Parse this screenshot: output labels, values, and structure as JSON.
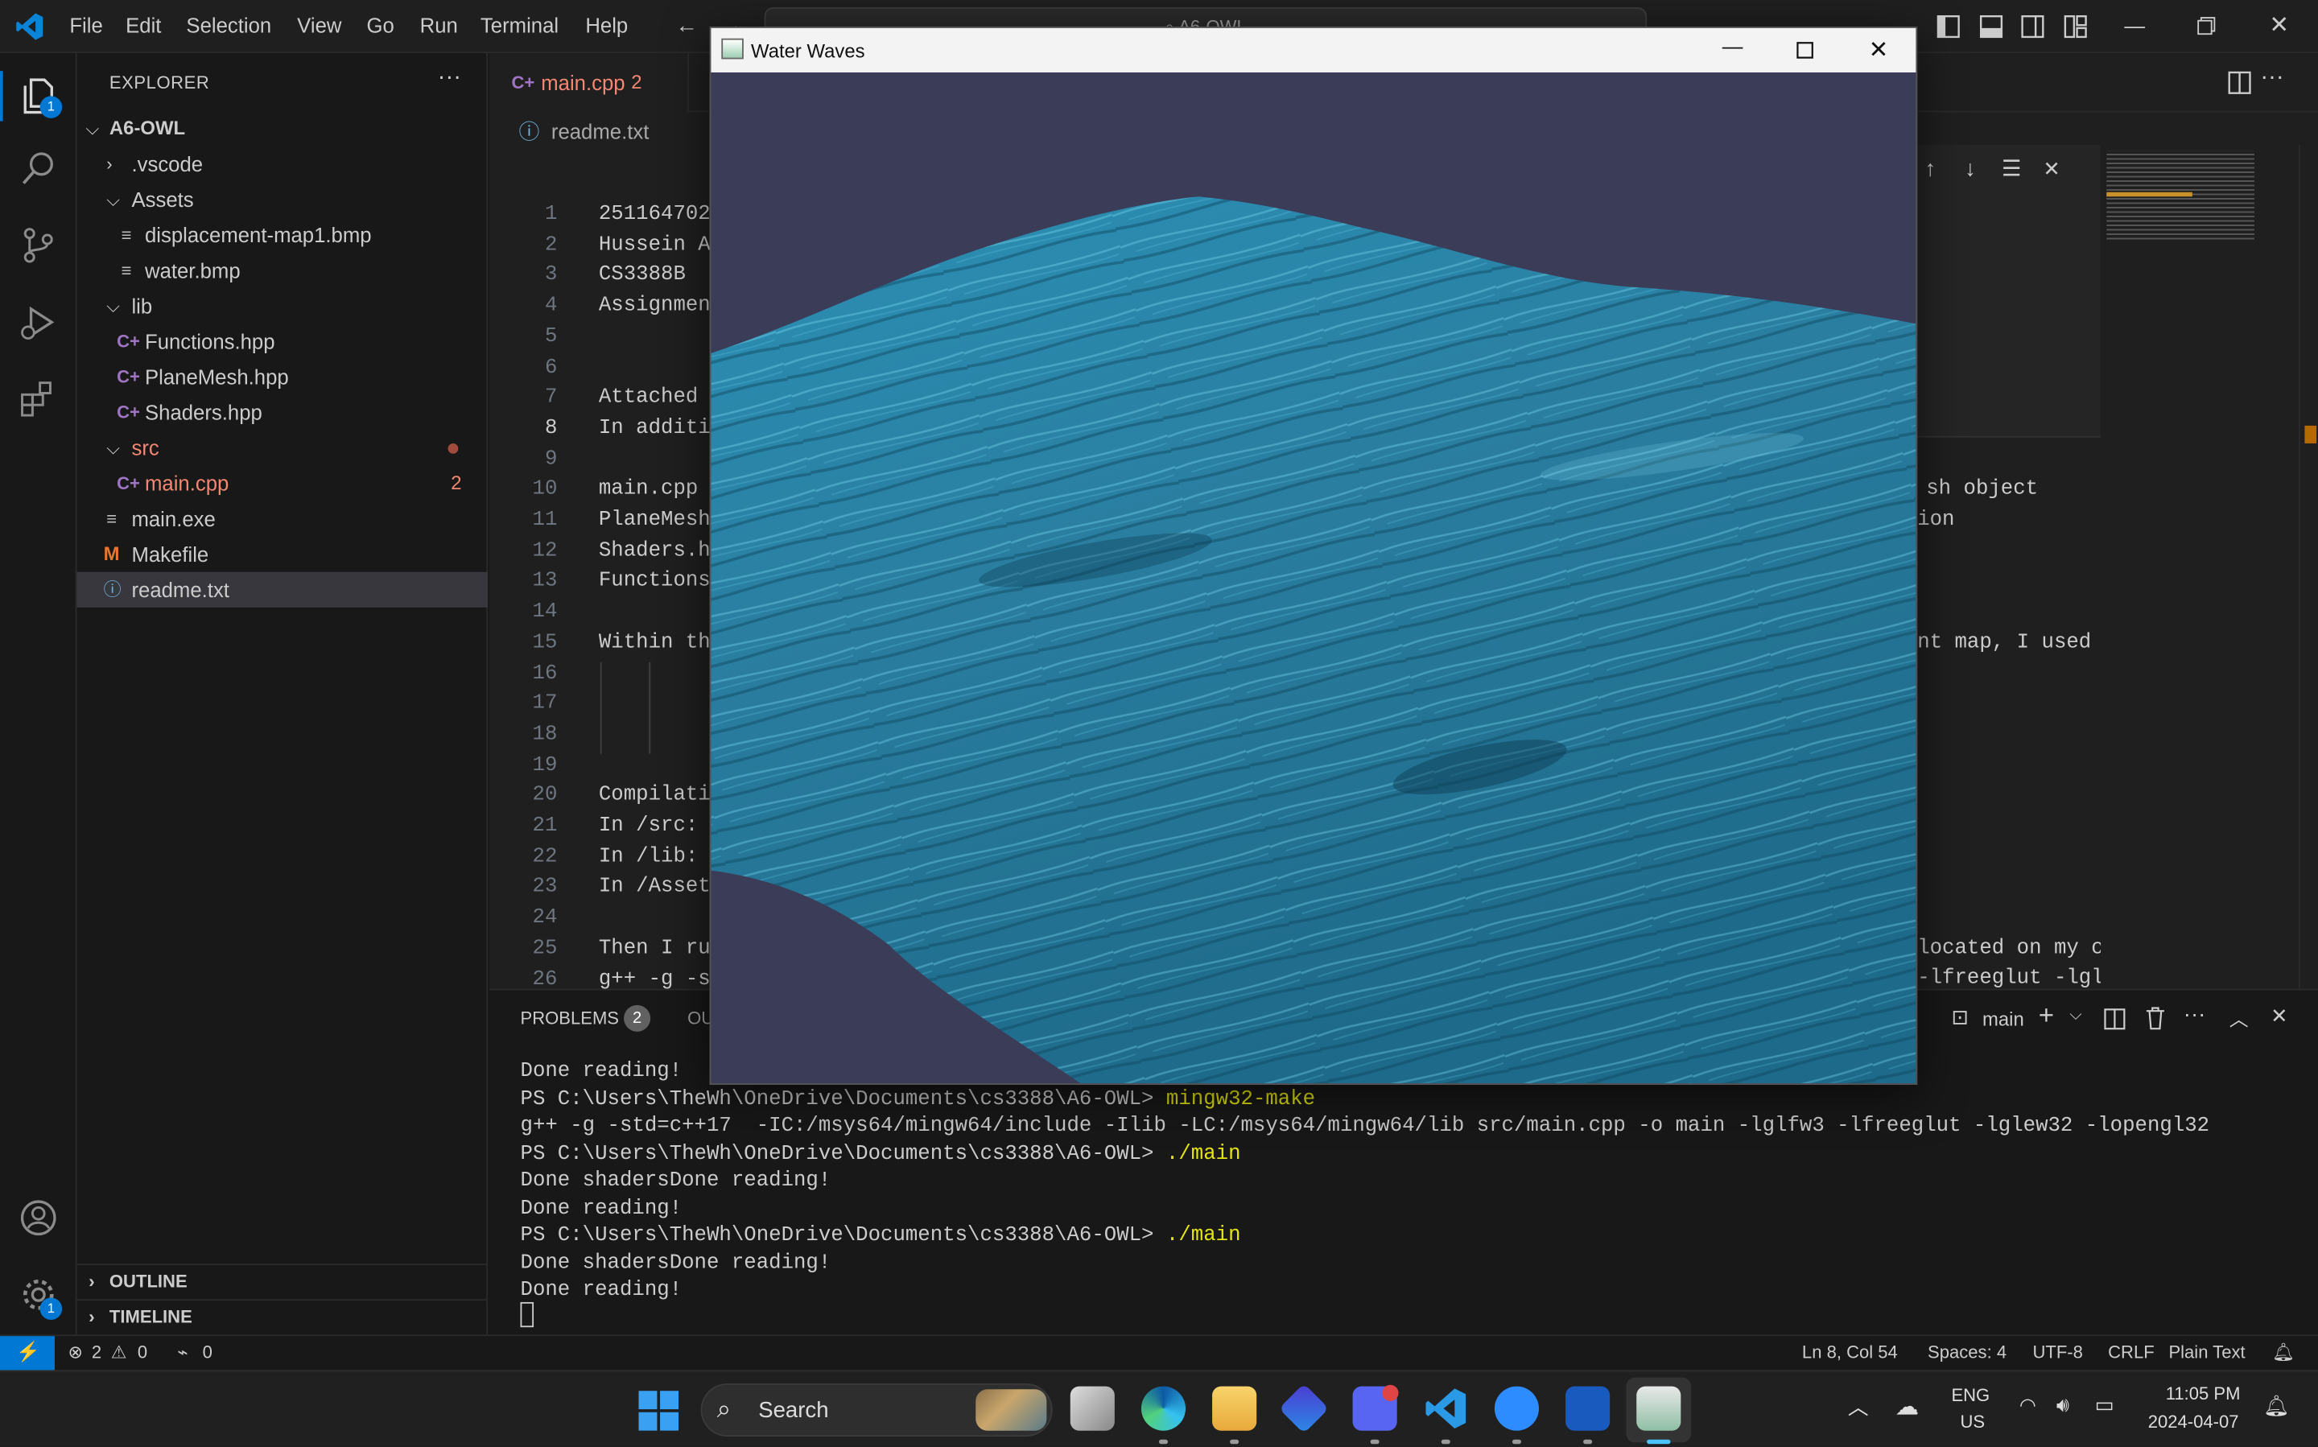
{
  "menu": [
    "File",
    "Edit",
    "Selection",
    "View",
    "Go",
    "Run",
    "Terminal",
    "Help"
  ],
  "search_box": "A6-OWL",
  "activity_badges": {
    "explorer": "1",
    "settings": "1"
  },
  "explorer": {
    "title": "EXPLORER",
    "root": "A6-OWL",
    "items": [
      {
        "name": ".vscode",
        "kind": "folder-closed"
      },
      {
        "name": "Assets",
        "kind": "folder-open"
      },
      {
        "name": "displacement-map1.bmp",
        "kind": "file"
      },
      {
        "name": "water.bmp",
        "kind": "file"
      },
      {
        "name": "lib",
        "kind": "folder-open"
      },
      {
        "name": "Functions.hpp",
        "kind": "cpp"
      },
      {
        "name": "PlaneMesh.hpp",
        "kind": "cpp"
      },
      {
        "name": "Shaders.hpp",
        "kind": "cpp"
      },
      {
        "name": "src",
        "kind": "folder-open"
      },
      {
        "name": "main.cpp",
        "kind": "cpp",
        "badge": "2"
      },
      {
        "name": "main.exe",
        "kind": "file"
      },
      {
        "name": "Makefile",
        "kind": "makefile"
      },
      {
        "name": "readme.txt",
        "kind": "text"
      }
    ],
    "outline": "OUTLINE",
    "timeline": "TIMELINE"
  },
  "tabs": [
    {
      "label": "main.cpp",
      "badge": "2"
    }
  ],
  "breadcrumb": "readme.txt",
  "editor_lines": [
    {
      "n": "1",
      "text": "251164702"
    },
    {
      "n": "2",
      "text": "Hussein A"
    },
    {
      "n": "3",
      "text": "CS3388B"
    },
    {
      "n": "4",
      "text": "Assignmen"
    },
    {
      "n": "5",
      "text": ""
    },
    {
      "n": "6",
      "text": ""
    },
    {
      "n": "7",
      "text": "Attached "
    },
    {
      "n": "8",
      "text": "In additi"
    },
    {
      "n": "9",
      "text": ""
    },
    {
      "n": "10",
      "text": "main.cpp "
    },
    {
      "n": "11",
      "text": "PlaneMesh"
    },
    {
      "n": "12",
      "text": "Shaders.h"
    },
    {
      "n": "13",
      "text": "Functions"
    },
    {
      "n": "14",
      "text": ""
    },
    {
      "n": "15",
      "text": "Within th"
    },
    {
      "n": "16",
      "text": ""
    },
    {
      "n": "17",
      "text": ""
    },
    {
      "n": "18",
      "text": ""
    },
    {
      "n": "19",
      "text": ""
    },
    {
      "n": "20",
      "text": "Compilati"
    },
    {
      "n": "21",
      "text": "In /src: "
    },
    {
      "n": "22",
      "text": "In /lib: "
    },
    {
      "n": "23",
      "text": "In /Asset"
    },
    {
      "n": "24",
      "text": ""
    },
    {
      "n": "25",
      "text": "Then I ru"
    },
    {
      "n": "26",
      "text": "g++ -g -s"
    }
  ],
  "editor_right": {
    "line10": "sh object",
    "line11": "ion",
    "line15": "nt map, I used",
    "line25": "located on my co",
    "line26": "-lfreeglut -lglu"
  },
  "panel": {
    "problems_label": "PROBLEMS",
    "problems_count": "2",
    "output_label": "OU",
    "terminal_name": "main",
    "lines": [
      {
        "prefix": "Done reading!",
        "cmd": ""
      },
      {
        "prefix": "PS C:\\Users\\TheWh\\OneDrive\\Documents\\cs3388\\A6-OWL> ",
        "cmd": "mingw32-make"
      },
      {
        "prefix": "g++ -g -std=c++17  -IC:/msys64/mingw64/include -Ilib -LC:/msys64/mingw64/lib src/main.cpp -o main -lglfw3 -lfreeglut -lglew32 -lopengl32",
        "cmd": ""
      },
      {
        "prefix": "PS C:\\Users\\TheWh\\OneDrive\\Documents\\cs3388\\A6-OWL> ",
        "cmd": "./main"
      },
      {
        "prefix": "Done shadersDone reading!",
        "cmd": ""
      },
      {
        "prefix": "Done reading!",
        "cmd": ""
      },
      {
        "prefix": "PS C:\\Users\\TheWh\\OneDrive\\Documents\\cs3388\\A6-OWL> ",
        "cmd": "./main"
      },
      {
        "prefix": "Done shadersDone reading!",
        "cmd": ""
      },
      {
        "prefix": "Done reading!",
        "cmd": ""
      }
    ]
  },
  "status": {
    "errors": "2",
    "warnings": "0",
    "ports": "0",
    "position": "Ln 8, Col 54",
    "spaces": "Spaces: 4",
    "encoding": "UTF-8",
    "eol": "CRLF",
    "language": "Plain Text"
  },
  "window": {
    "title": "Water Waves"
  },
  "taskbar": {
    "search": "Search",
    "lang_top": "ENG",
    "lang_bottom": "US",
    "time": "11:05 PM",
    "date": "2024-04-07"
  },
  "colors": {
    "accent": "#0078d4",
    "modified": "#f48771",
    "terminal_cmd": "#e5e510",
    "water": "#2f8fb0",
    "window_bg": "#3b3c58"
  }
}
